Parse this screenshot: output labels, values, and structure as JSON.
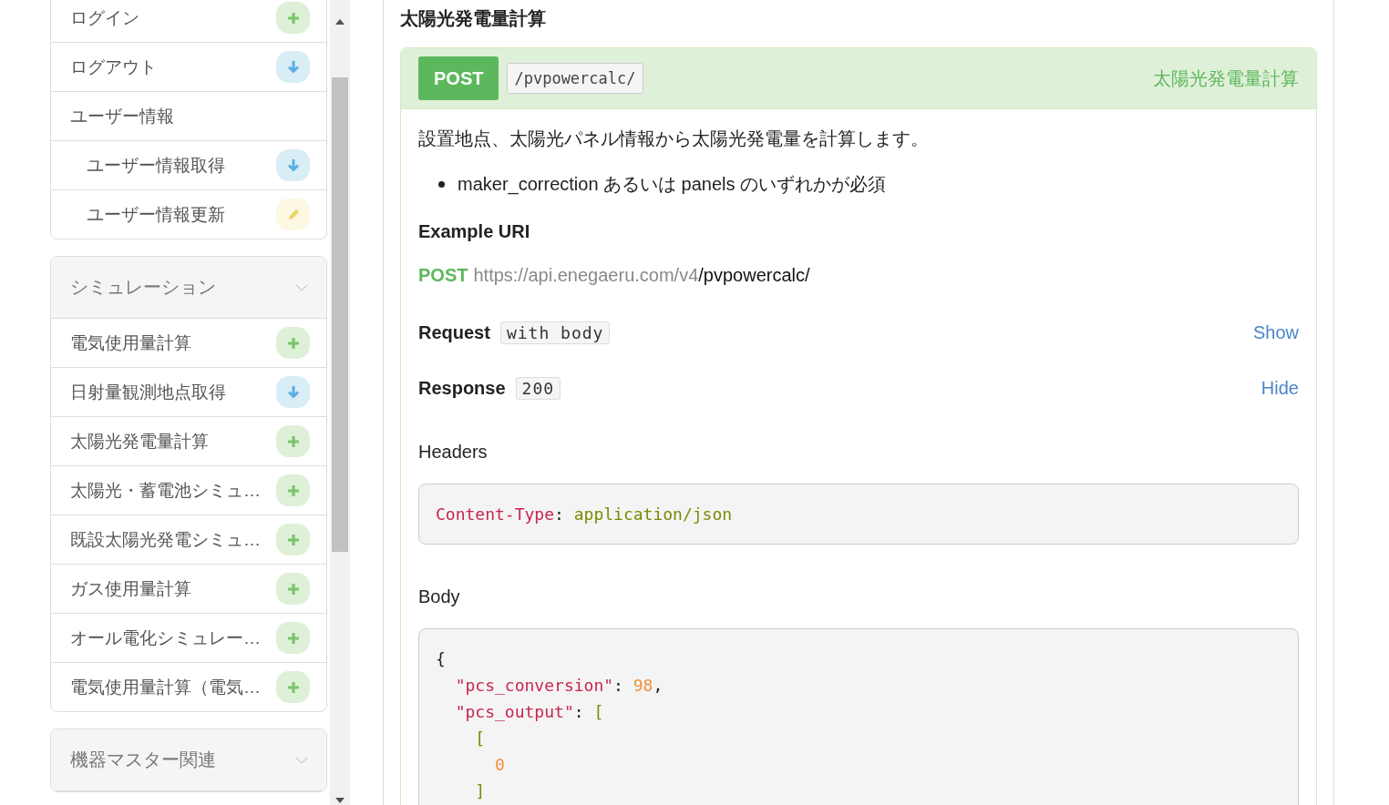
{
  "sidebar": {
    "groups": [
      {
        "items": [
          {
            "label": "ログイン",
            "kind": "create"
          },
          {
            "label": "ログアウト",
            "kind": "get"
          },
          {
            "label": "ユーザー情報",
            "children": [
              {
                "label": "ユーザー情報取得",
                "kind": "get"
              },
              {
                "label": "ユーザー情報更新",
                "kind": "update"
              }
            ]
          }
        ]
      },
      {
        "title": "シミュレーション",
        "items": [
          {
            "label": "電気使用量計算",
            "kind": "create"
          },
          {
            "label": "日射量観測地点取得",
            "kind": "get"
          },
          {
            "label": "太陽光発電量計算",
            "kind": "create"
          },
          {
            "label": "太陽光・蓄電池シミュ…",
            "kind": "create"
          },
          {
            "label": "既設太陽光発電シミュ…",
            "kind": "create"
          },
          {
            "label": "ガス使用量計算",
            "kind": "create"
          },
          {
            "label": "オール電化シミュレー…",
            "kind": "create"
          },
          {
            "label": "電気使用量計算（電気…",
            "kind": "create"
          }
        ]
      },
      {
        "title": "機器マスター関連"
      }
    ]
  },
  "heading": "太陽光発電量計算",
  "endpoint": {
    "method": "POST",
    "path": "/pvpowercalc/",
    "title": "太陽光発電量計算",
    "description": "設置地点、太陽光パネル情報から太陽光発電量を計算します。",
    "bullets": [
      "maker_correction あるいは panels のいずれかが必須"
    ],
    "example_heading": "Example URI",
    "example_uri": {
      "method": "POST",
      "base": "https://api.enegaeru.com/v4",
      "path": "/pvpowercalc/"
    },
    "request": {
      "label": "Request",
      "tag": "with body",
      "toggle": "Show"
    },
    "response": {
      "label": "Response",
      "tag": "200",
      "toggle": "Hide",
      "sections": [
        {
          "label": "Headers",
          "lines": [
            [
              {
                "kind": "key",
                "text": "Content-Type"
              },
              {
                "kind": "punct",
                "text": ": "
              },
              {
                "kind": "string",
                "text": "application/json"
              }
            ]
          ]
        },
        {
          "label": "Body",
          "lines": [
            [
              {
                "kind": "punct",
                "text": "{"
              }
            ],
            [
              {
                "kind": "key",
                "text": "  \"pcs_conversion\""
              },
              {
                "kind": "punct",
                "text": ": "
              },
              {
                "kind": "number",
                "text": "98"
              },
              {
                "kind": "punct",
                "text": ","
              }
            ],
            [
              {
                "kind": "key",
                "text": "  \"pcs_output\""
              },
              {
                "kind": "punct",
                "text": ": "
              },
              {
                "kind": "string",
                "text": "["
              }
            ],
            [
              {
                "kind": "string",
                "text": "    ["
              }
            ],
            [
              {
                "kind": "number",
                "text": "      0"
              }
            ],
            [
              {
                "kind": "string",
                "text": "    ]"
              }
            ]
          ]
        }
      ]
    }
  }
}
